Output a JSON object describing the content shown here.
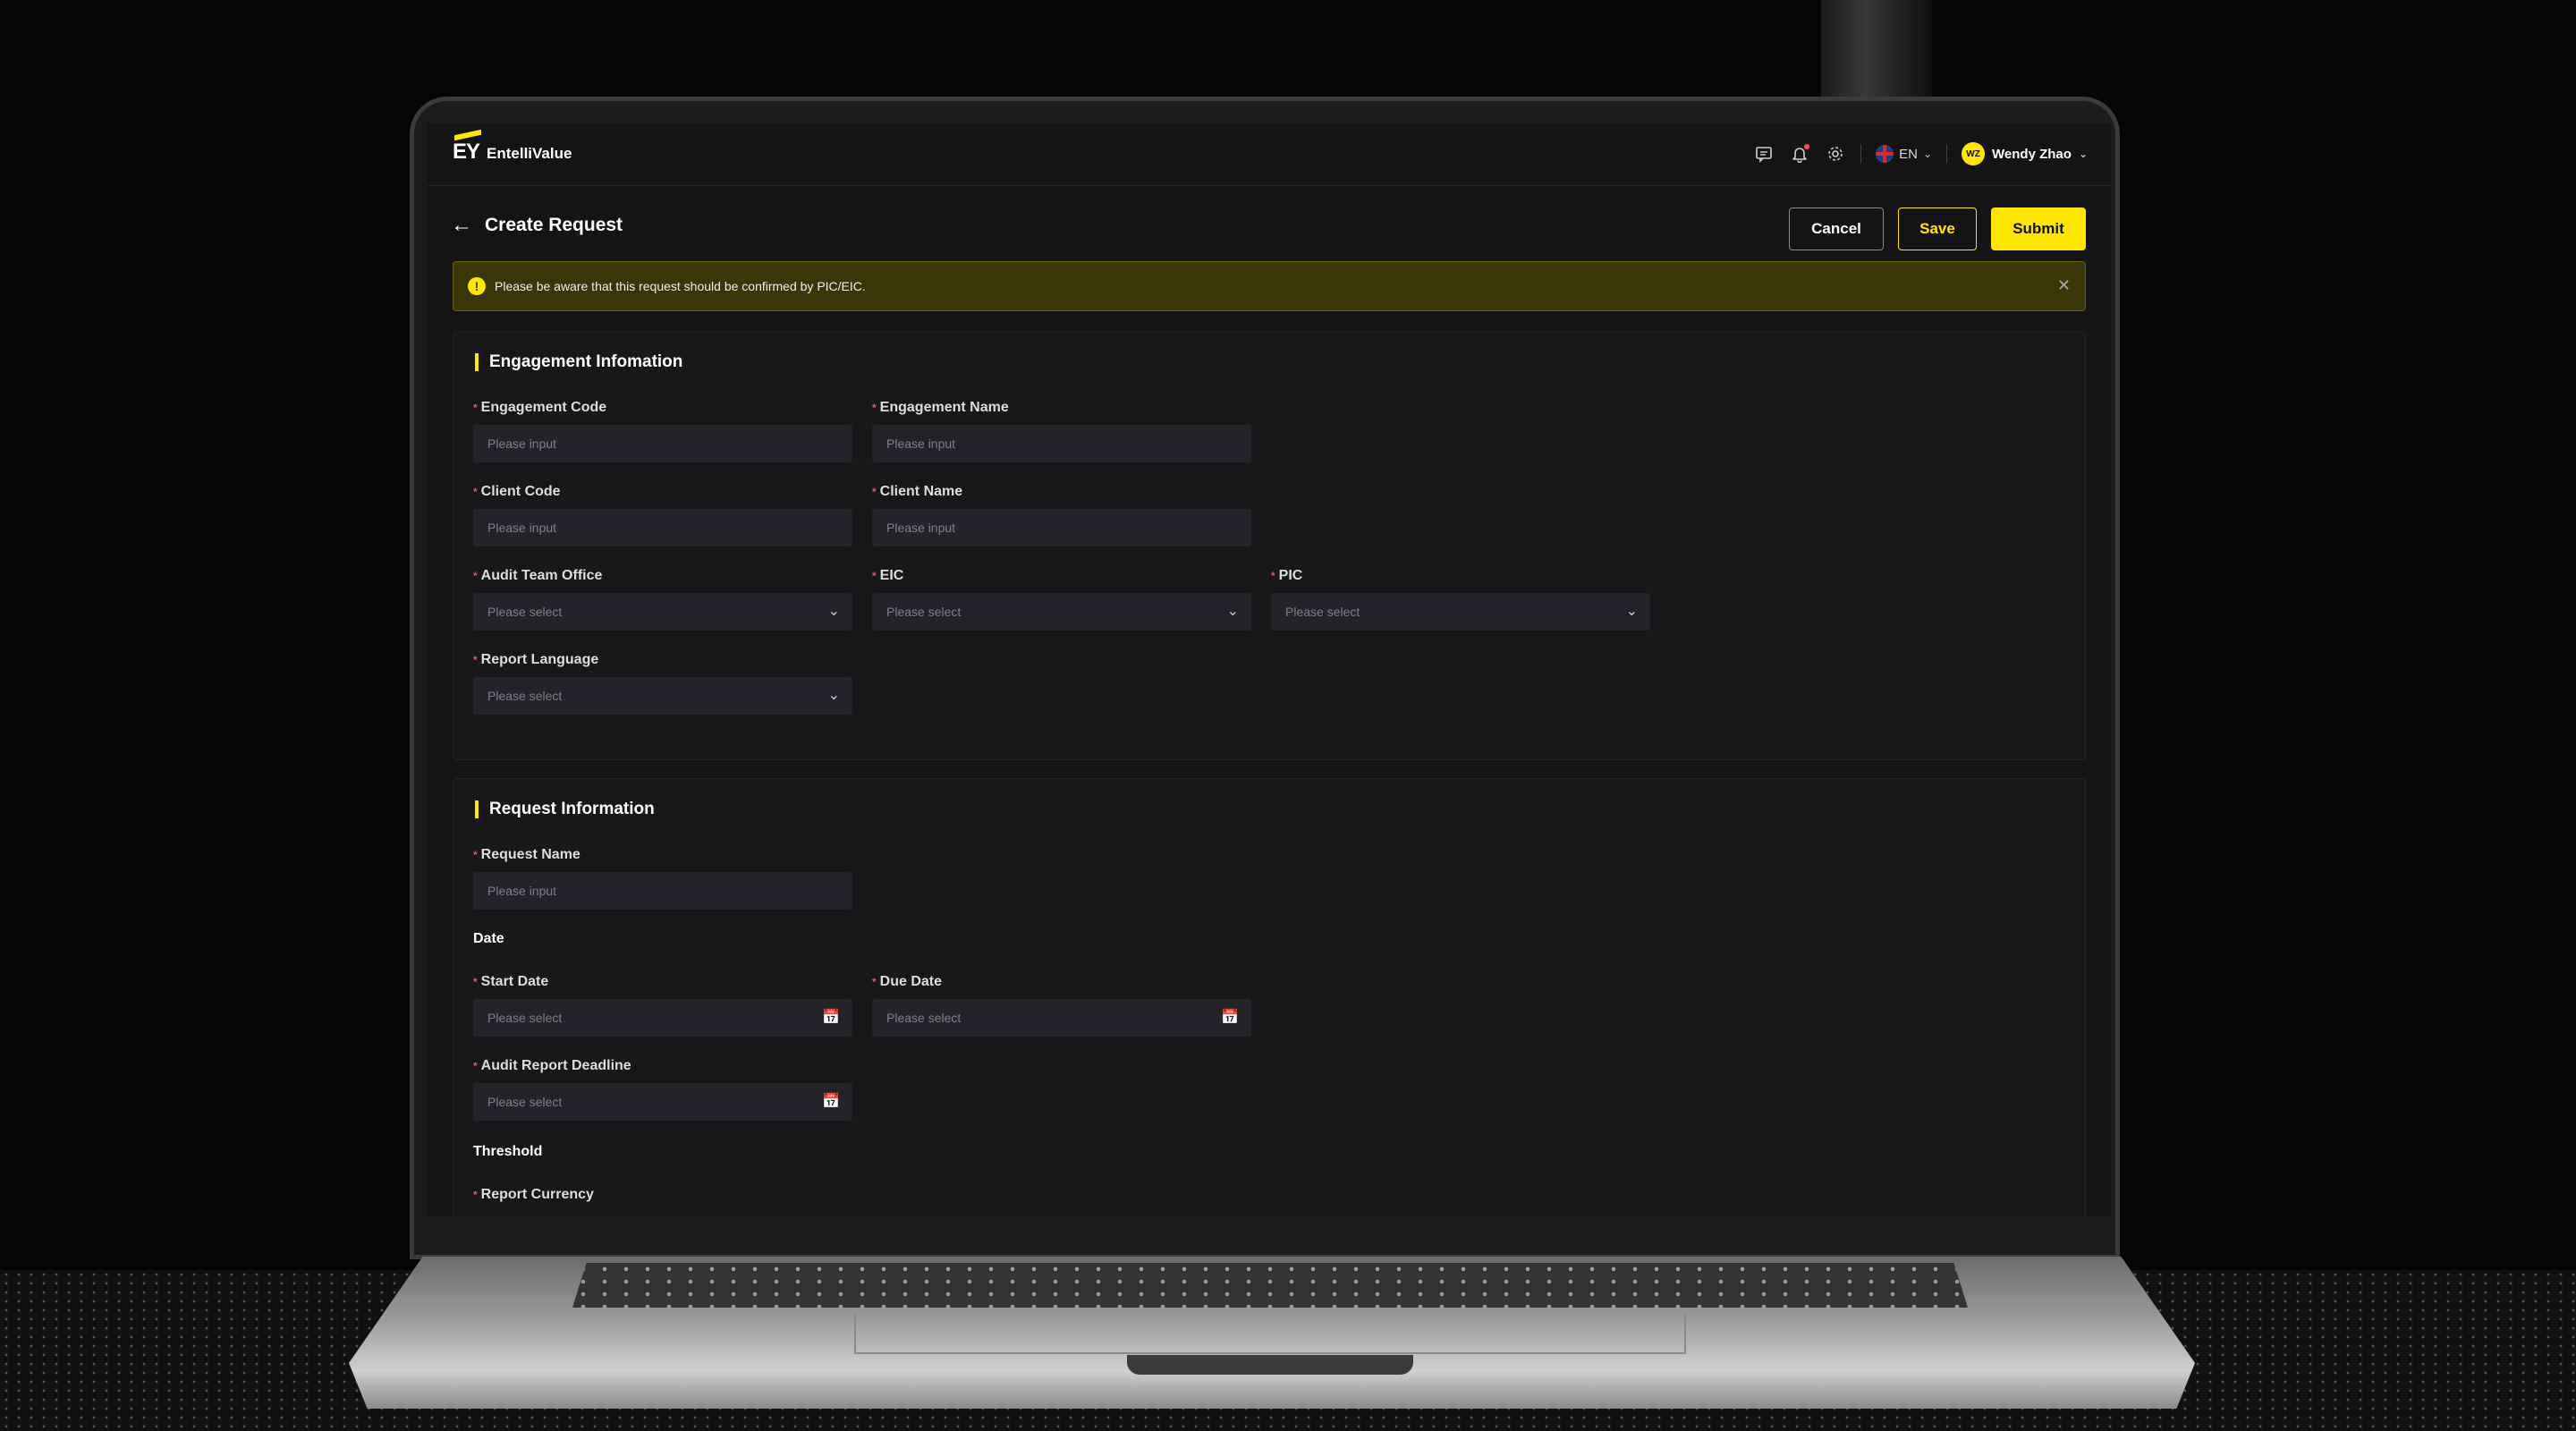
{
  "app": {
    "logo_mark": "EY",
    "name": "EntelliValue",
    "language": "EN",
    "user": {
      "initials": "WZ",
      "name": "Wendy Zhao"
    }
  },
  "page": {
    "title": "Create Request",
    "cancel_label": "Cancel",
    "save_label": "Save",
    "submit_label": "Submit"
  },
  "alert": {
    "text": "Please be aware that this request should be confirmed by PIC/EIC."
  },
  "engagement": {
    "title": "Engagement Infomation",
    "engagement_code": {
      "label": "Engagement Code",
      "placeholder": "Please input"
    },
    "engagement_name": {
      "label": "Engagement Name",
      "placeholder": "Please input"
    },
    "client_code": {
      "label": "Client Code",
      "placeholder": "Please input"
    },
    "client_name": {
      "label": "Client Name",
      "placeholder": "Please input"
    },
    "audit_team_office": {
      "label": "Audit Team Office",
      "placeholder": "Please select"
    },
    "eic": {
      "label": "EIC",
      "placeholder": "Please select"
    },
    "pic": {
      "label": "PIC",
      "placeholder": "Please select"
    },
    "report_language": {
      "label": "Report Language",
      "placeholder": "Please select"
    }
  },
  "request": {
    "title": "Request Information",
    "request_name": {
      "label": "Request Name",
      "placeholder": "Please input"
    },
    "date_heading": "Date",
    "start_date": {
      "label": "Start Date",
      "placeholder": "Please select"
    },
    "due_date": {
      "label": "Due Date",
      "placeholder": "Please select"
    },
    "audit_report_deadline": {
      "label": "Audit Report Deadline",
      "placeholder": "Please select"
    },
    "threshold_heading": "Threshold",
    "report_currency": {
      "label": "Report Currency"
    }
  },
  "icons": {
    "back": "arrow-left-icon",
    "chat": "message-icon",
    "bell": "bell-icon",
    "settings": "gear-icon",
    "flag": "uk-flag-icon",
    "chevron": "chevron-down-icon",
    "calendar": "calendar-icon",
    "close": "close-icon",
    "warning": "warning-icon"
  },
  "colors": {
    "accent": "#ffe600",
    "required": "#ff4d4f",
    "background": "#141416",
    "card": "#18181b",
    "alert_bg": "#3b3608"
  }
}
